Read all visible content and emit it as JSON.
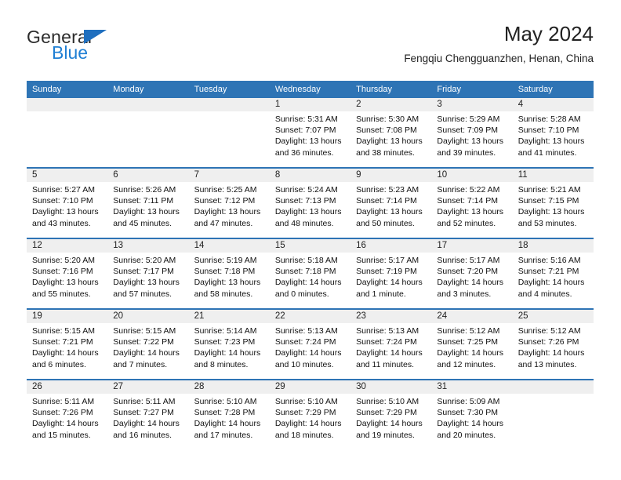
{
  "brand": {
    "word1": "General",
    "word2": "Blue",
    "accent_color": "#1f6fbf",
    "blue_text_color": "#1f7fd4"
  },
  "header": {
    "title": "May 2024",
    "subtitle": "Fengqiu Chengguanzhen, Henan, China"
  },
  "theme": {
    "header_blue": "#2e74b5",
    "day_band_gray": "#efefef",
    "text": "#111111"
  },
  "weekdays": [
    "Sunday",
    "Monday",
    "Tuesday",
    "Wednesday",
    "Thursday",
    "Friday",
    "Saturday"
  ],
  "weeks": [
    [
      {
        "day": "",
        "lines": []
      },
      {
        "day": "",
        "lines": []
      },
      {
        "day": "",
        "lines": []
      },
      {
        "day": "1",
        "lines": [
          "Sunrise: 5:31 AM",
          "Sunset: 7:07 PM",
          "Daylight: 13 hours",
          "and 36 minutes."
        ]
      },
      {
        "day": "2",
        "lines": [
          "Sunrise: 5:30 AM",
          "Sunset: 7:08 PM",
          "Daylight: 13 hours",
          "and 38 minutes."
        ]
      },
      {
        "day": "3",
        "lines": [
          "Sunrise: 5:29 AM",
          "Sunset: 7:09 PM",
          "Daylight: 13 hours",
          "and 39 minutes."
        ]
      },
      {
        "day": "4",
        "lines": [
          "Sunrise: 5:28 AM",
          "Sunset: 7:10 PM",
          "Daylight: 13 hours",
          "and 41 minutes."
        ]
      }
    ],
    [
      {
        "day": "5",
        "lines": [
          "Sunrise: 5:27 AM",
          "Sunset: 7:10 PM",
          "Daylight: 13 hours",
          "and 43 minutes."
        ]
      },
      {
        "day": "6",
        "lines": [
          "Sunrise: 5:26 AM",
          "Sunset: 7:11 PM",
          "Daylight: 13 hours",
          "and 45 minutes."
        ]
      },
      {
        "day": "7",
        "lines": [
          "Sunrise: 5:25 AM",
          "Sunset: 7:12 PM",
          "Daylight: 13 hours",
          "and 47 minutes."
        ]
      },
      {
        "day": "8",
        "lines": [
          "Sunrise: 5:24 AM",
          "Sunset: 7:13 PM",
          "Daylight: 13 hours",
          "and 48 minutes."
        ]
      },
      {
        "day": "9",
        "lines": [
          "Sunrise: 5:23 AM",
          "Sunset: 7:14 PM",
          "Daylight: 13 hours",
          "and 50 minutes."
        ]
      },
      {
        "day": "10",
        "lines": [
          "Sunrise: 5:22 AM",
          "Sunset: 7:14 PM",
          "Daylight: 13 hours",
          "and 52 minutes."
        ]
      },
      {
        "day": "11",
        "lines": [
          "Sunrise: 5:21 AM",
          "Sunset: 7:15 PM",
          "Daylight: 13 hours",
          "and 53 minutes."
        ]
      }
    ],
    [
      {
        "day": "12",
        "lines": [
          "Sunrise: 5:20 AM",
          "Sunset: 7:16 PM",
          "Daylight: 13 hours",
          "and 55 minutes."
        ]
      },
      {
        "day": "13",
        "lines": [
          "Sunrise: 5:20 AM",
          "Sunset: 7:17 PM",
          "Daylight: 13 hours",
          "and 57 minutes."
        ]
      },
      {
        "day": "14",
        "lines": [
          "Sunrise: 5:19 AM",
          "Sunset: 7:18 PM",
          "Daylight: 13 hours",
          "and 58 minutes."
        ]
      },
      {
        "day": "15",
        "lines": [
          "Sunrise: 5:18 AM",
          "Sunset: 7:18 PM",
          "Daylight: 14 hours",
          "and 0 minutes."
        ]
      },
      {
        "day": "16",
        "lines": [
          "Sunrise: 5:17 AM",
          "Sunset: 7:19 PM",
          "Daylight: 14 hours",
          "and 1 minute."
        ]
      },
      {
        "day": "17",
        "lines": [
          "Sunrise: 5:17 AM",
          "Sunset: 7:20 PM",
          "Daylight: 14 hours",
          "and 3 minutes."
        ]
      },
      {
        "day": "18",
        "lines": [
          "Sunrise: 5:16 AM",
          "Sunset: 7:21 PM",
          "Daylight: 14 hours",
          "and 4 minutes."
        ]
      }
    ],
    [
      {
        "day": "19",
        "lines": [
          "Sunrise: 5:15 AM",
          "Sunset: 7:21 PM",
          "Daylight: 14 hours",
          "and 6 minutes."
        ]
      },
      {
        "day": "20",
        "lines": [
          "Sunrise: 5:15 AM",
          "Sunset: 7:22 PM",
          "Daylight: 14 hours",
          "and 7 minutes."
        ]
      },
      {
        "day": "21",
        "lines": [
          "Sunrise: 5:14 AM",
          "Sunset: 7:23 PM",
          "Daylight: 14 hours",
          "and 8 minutes."
        ]
      },
      {
        "day": "22",
        "lines": [
          "Sunrise: 5:13 AM",
          "Sunset: 7:24 PM",
          "Daylight: 14 hours",
          "and 10 minutes."
        ]
      },
      {
        "day": "23",
        "lines": [
          "Sunrise: 5:13 AM",
          "Sunset: 7:24 PM",
          "Daylight: 14 hours",
          "and 11 minutes."
        ]
      },
      {
        "day": "24",
        "lines": [
          "Sunrise: 5:12 AM",
          "Sunset: 7:25 PM",
          "Daylight: 14 hours",
          "and 12 minutes."
        ]
      },
      {
        "day": "25",
        "lines": [
          "Sunrise: 5:12 AM",
          "Sunset: 7:26 PM",
          "Daylight: 14 hours",
          "and 13 minutes."
        ]
      }
    ],
    [
      {
        "day": "26",
        "lines": [
          "Sunrise: 5:11 AM",
          "Sunset: 7:26 PM",
          "Daylight: 14 hours",
          "and 15 minutes."
        ]
      },
      {
        "day": "27",
        "lines": [
          "Sunrise: 5:11 AM",
          "Sunset: 7:27 PM",
          "Daylight: 14 hours",
          "and 16 minutes."
        ]
      },
      {
        "day": "28",
        "lines": [
          "Sunrise: 5:10 AM",
          "Sunset: 7:28 PM",
          "Daylight: 14 hours",
          "and 17 minutes."
        ]
      },
      {
        "day": "29",
        "lines": [
          "Sunrise: 5:10 AM",
          "Sunset: 7:29 PM",
          "Daylight: 14 hours",
          "and 18 minutes."
        ]
      },
      {
        "day": "30",
        "lines": [
          "Sunrise: 5:10 AM",
          "Sunset: 7:29 PM",
          "Daylight: 14 hours",
          "and 19 minutes."
        ]
      },
      {
        "day": "31",
        "lines": [
          "Sunrise: 5:09 AM",
          "Sunset: 7:30 PM",
          "Daylight: 14 hours",
          "and 20 minutes."
        ]
      },
      {
        "day": "",
        "lines": []
      }
    ]
  ]
}
